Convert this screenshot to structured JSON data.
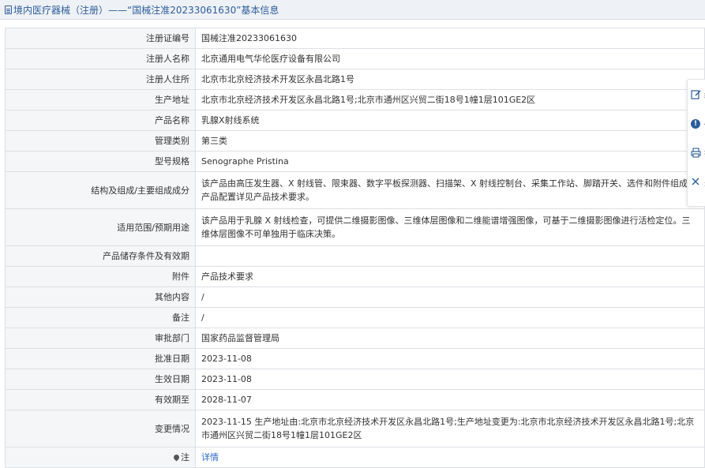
{
  "header": {
    "title": "境内医疗器械（注册）——“国械注准20233061630”基本信息"
  },
  "rows": [
    {
      "label": "注册证编号",
      "value": "国械注准20233061630"
    },
    {
      "label": "注册人名称",
      "value": "北京通用电气华伦医疗设备有限公司"
    },
    {
      "label": "注册人住所",
      "value": "北京市北京经济技术开发区永昌北路1号"
    },
    {
      "label": "生产地址",
      "value": "北京市北京经济技术开发区永昌北路1号;北京市通州区兴贸二街18号1幢1层101GE2区"
    },
    {
      "label": "产品名称",
      "value": "乳腺X射线系统"
    },
    {
      "label": "管理类别",
      "value": "第三类"
    },
    {
      "label": "型号规格",
      "value": "Senographe Pristina"
    },
    {
      "label": "结构及组成/主要组成成分",
      "value": "该产品由高压发生器、X 射线管、限束器、数字平板探测器、扫描架、X 射线控制台、采集工作站、脚踏开关、选件和附件组成，产品配置详见产品技术要求。"
    },
    {
      "label": "适用范围/预期用途",
      "value": "该产品用于乳腺 X 射线检查，可提供二维摄影图像、三维体层图像和二维能谱增强图像，可基于二维摄影图像进行活检定位。三维体层图像不可单独用于临床决策。"
    },
    {
      "label": "产品储存条件及有效期",
      "value": ""
    },
    {
      "label": "附件",
      "value": "产品技术要求"
    },
    {
      "label": "其他内容",
      "value": "/"
    },
    {
      "label": "备注",
      "value": "/"
    },
    {
      "label": "审批部门",
      "value": "国家药品监督管理局"
    },
    {
      "label": "批准日期",
      "value": "2023-11-08"
    },
    {
      "label": "生效日期",
      "value": "2023-11-08"
    },
    {
      "label": "有效期至",
      "value": "2028-11-07"
    },
    {
      "label": "变更情况",
      "value": "2023-11-15 生产地址由:北京市北京经济技术开发区永昌北路1号;生产地址变更为:北京市北京经济技术开发区永昌北路1号;北京市通州区兴贸二街18号1幢1层101GE2区"
    }
  ],
  "note_row": {
    "label": "注",
    "link_text": "详情"
  },
  "sidebar": {
    "edit_label": "编",
    "info_label": "信",
    "print_label": "打",
    "close_label": "关"
  },
  "colors": {
    "accent": "#2d5d9b",
    "link": "#2b6ac4",
    "label_bg": "#f5f6f8",
    "border": "#dcdfe4"
  }
}
